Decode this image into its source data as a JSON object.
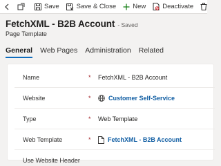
{
  "command_bar": {
    "save_label": "Save",
    "save_close_label": "Save & Close",
    "new_label": "New",
    "deactivate_label": "Deactivate"
  },
  "header": {
    "title": "FetchXML - B2B Account",
    "status": "- Saved",
    "entity_type": "Page Template"
  },
  "tabs": [
    {
      "label": "General",
      "active": true
    },
    {
      "label": "Web Pages",
      "active": false
    },
    {
      "label": "Administration",
      "active": false
    },
    {
      "label": "Related",
      "active": false
    }
  ],
  "form": {
    "fields": [
      {
        "label": "Name",
        "required": "*",
        "value": "FetchXML - B2B Account"
      },
      {
        "label": "Website",
        "required": "*",
        "value": "Customer Self-Service",
        "icon": "globe-icon"
      },
      {
        "label": "Type",
        "required": "*",
        "value": "Web Template"
      },
      {
        "label": "Web Template",
        "required": "*",
        "value": "FetchXML - B2B Account",
        "icon": "document-icon"
      },
      {
        "label": "Use Website Header"
      }
    ]
  },
  "colors": {
    "accent": "#0f6cbd",
    "link": "#115ea3",
    "required": "#a4262c",
    "new_plus": "#107c10",
    "deactivate": "#d13438"
  }
}
